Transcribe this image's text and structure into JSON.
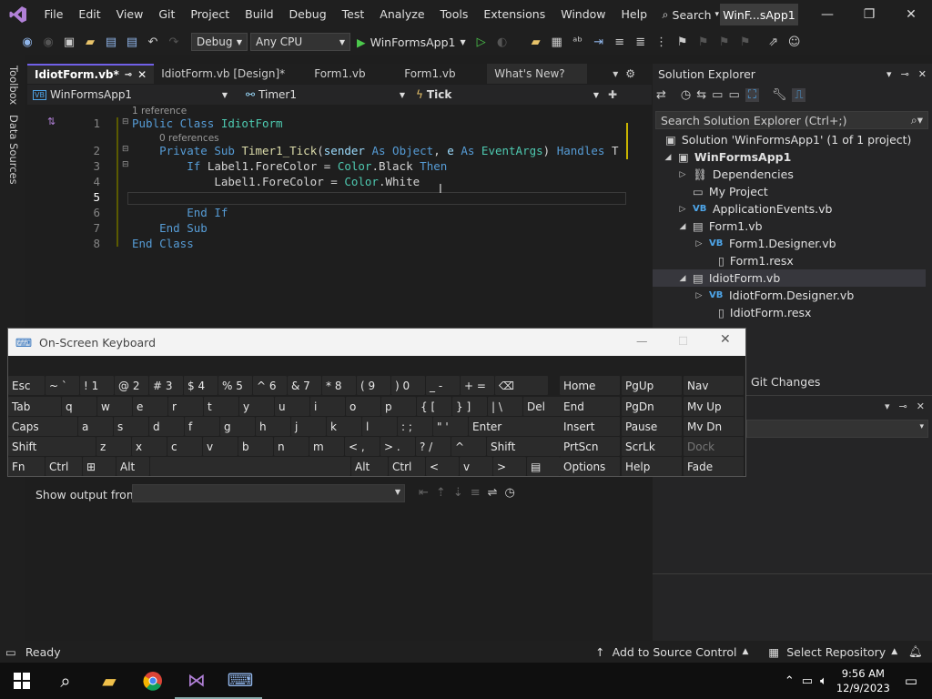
{
  "menu": {
    "items": [
      "File",
      "Edit",
      "View",
      "Git",
      "Project",
      "Build",
      "Debug",
      "Test",
      "Analyze",
      "Tools",
      "Extensions",
      "Window",
      "Help"
    ],
    "search_label": "Search",
    "project_title": "WinF...sApp1"
  },
  "toolbar": {
    "config": "Debug",
    "platform": "Any CPU",
    "run_target": "WinFormsApp1"
  },
  "sidebar": {
    "toolbox": "Toolbox",
    "data_sources": "Data Sources"
  },
  "tabs": [
    {
      "label": "IdiotForm.vb*",
      "active": true
    },
    {
      "label": "IdiotForm.vb [Design]*"
    },
    {
      "label": "Form1.vb"
    },
    {
      "label": "Form1.vb"
    },
    {
      "label": "What's New?"
    }
  ],
  "navbar": {
    "project": "WinFormsApp1",
    "object": "Timer1",
    "event": "Tick"
  },
  "editor": {
    "lens_class": "1 reference",
    "lens_sub": "0 references",
    "line_numbers": [
      "1",
      "2",
      "3",
      "4",
      "5",
      "6",
      "7",
      "8"
    ],
    "lines": {
      "l1_kw": "Public Class",
      "l1_name": "IdiotForm",
      "l2_kw1": "Private Sub",
      "l2_fn": "Timer1_Tick",
      "l2_p1": "sender",
      "l2_as1": "As",
      "l2_t1": "Object",
      "l2_p2": "e",
      "l2_as2": "As",
      "l2_t2": "EventArgs",
      "l2_handles": "Handles",
      "l2_tail": "T",
      "l3_if": "If",
      "l3_obj": "Label1",
      "l3_prop": "ForeColor",
      "l3_eq": "=",
      "l3_ty": "Color",
      "l3_val": "Black",
      "l3_then": "Then",
      "l4_obj": "Label1",
      "l4_prop": "ForeColor",
      "l4_eq": "=",
      "l4_ty": "Color",
      "l4_val": "White",
      "l6": "End If",
      "l7": "End Sub",
      "l8": "End Class"
    }
  },
  "solution_explorer": {
    "title": "Solution Explorer",
    "search_placeholder": "Search Solution Explorer (Ctrl+;)",
    "items": [
      {
        "label": "Solution 'WinFormsApp1' (1 of 1 project)"
      },
      {
        "label": "WinFormsApp1"
      },
      {
        "label": "Dependencies"
      },
      {
        "label": "My Project"
      },
      {
        "label": "ApplicationEvents.vb"
      },
      {
        "label": "Form1.vb"
      },
      {
        "label": "Form1.Designer.vb"
      },
      {
        "label": "Form1.resx"
      },
      {
        "label": "IdiotForm.vb"
      },
      {
        "label": "IdiotForm.Designer.vb"
      },
      {
        "label": "IdiotForm.resx"
      }
    ],
    "git_changes": "Git Changes"
  },
  "osk": {
    "title": "On-Screen Keyboard",
    "row1": [
      "Esc",
      "~ `",
      "! 1",
      "@ 2",
      "# 3",
      "$ 4",
      "% 5",
      "^ 6",
      "& 7",
      "* 8",
      "( 9",
      ") 0",
      "_ -",
      "+ =",
      "⌫"
    ],
    "row2": [
      "Tab",
      "q",
      "w",
      "e",
      "r",
      "t",
      "y",
      "u",
      "i",
      "o",
      "p",
      "{ [",
      "} ]",
      "| \\",
      "Del"
    ],
    "row3": [
      "Caps",
      "a",
      "s",
      "d",
      "f",
      "g",
      "h",
      "j",
      "k",
      "l",
      ": ;",
      "\" '",
      "Enter"
    ],
    "row4": [
      "Shift",
      "z",
      "x",
      "c",
      "v",
      "b",
      "n",
      "m",
      "< ,",
      "> .",
      "? /",
      "^",
      "Shift"
    ],
    "row5": [
      "Fn",
      "Ctrl",
      "⊞",
      "Alt",
      "",
      "Alt",
      "Ctrl",
      "<",
      "v",
      ">",
      "▤"
    ],
    "nav": [
      [
        "Home",
        "PgUp",
        "Nav"
      ],
      [
        "End",
        "PgDn",
        "Mv Up"
      ],
      [
        "Insert",
        "Pause",
        "Mv Dn"
      ],
      [
        "PrtScn",
        "ScrLk",
        "Dock"
      ],
      [
        "Options",
        "Help",
        "Fade"
      ]
    ]
  },
  "output": {
    "show_from": "Show output from:"
  },
  "status": {
    "ready": "Ready",
    "source_control": "Add to Source Control",
    "repo": "Select Repository"
  },
  "taskbar": {
    "time": "9:56 AM",
    "date": "12/9/2023"
  }
}
